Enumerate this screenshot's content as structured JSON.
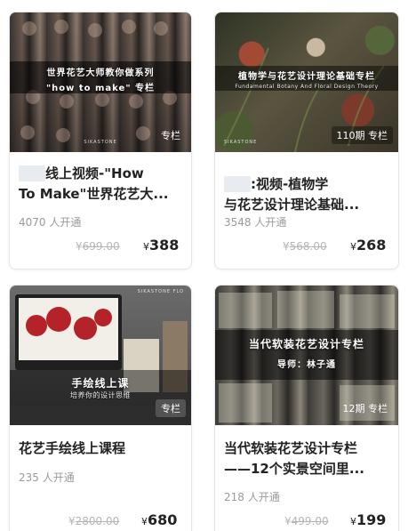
{
  "courses": [
    {
      "cover": {
        "title_line1": "世界花艺大师教你做系列",
        "title_line2": "\"how to make\" 专栏",
        "brand": "SIKASTONE",
        "badge": "专栏"
      },
      "title_line1": "线上视频-\"How",
      "title_line2": "To Make\"世界花艺大...",
      "subscribers": "4070 人开通",
      "original_price": "699.00",
      "price": "388",
      "currency": "¥"
    },
    {
      "cover": {
        "title_line1": "植物学与花艺设计理论基础专栏",
        "subtitle": "Fundamental Botany And Floral Design Theory",
        "brand": "SIKASTONE",
        "badge": "110期 专栏"
      },
      "title_line1": ":视频-植物学",
      "title_line2": "与花艺设计理论基础...",
      "subscribers": "3548 人开通",
      "original_price": "568.00",
      "price": "268",
      "currency": "¥"
    },
    {
      "cover": {
        "title_line1": "手绘线上课",
        "subtitle": "培养你的设计思维",
        "brand": "SIKASTONE FLO",
        "badge": "专栏"
      },
      "title_line1": "花艺手绘线上课程",
      "subscribers": "235 人开通",
      "original_price": "2800.00",
      "price": "680",
      "currency": "¥"
    },
    {
      "cover": {
        "title_line1": "当代软装花艺设计专栏",
        "title_line2": "导师：林子通",
        "badge": "12期 专栏"
      },
      "title_line1": "当代软装花艺设计专栏",
      "title_line2": "——12个实景空间里...",
      "subscribers": "218 人开通",
      "original_price": "499.00",
      "price": "199",
      "currency": "¥"
    }
  ]
}
